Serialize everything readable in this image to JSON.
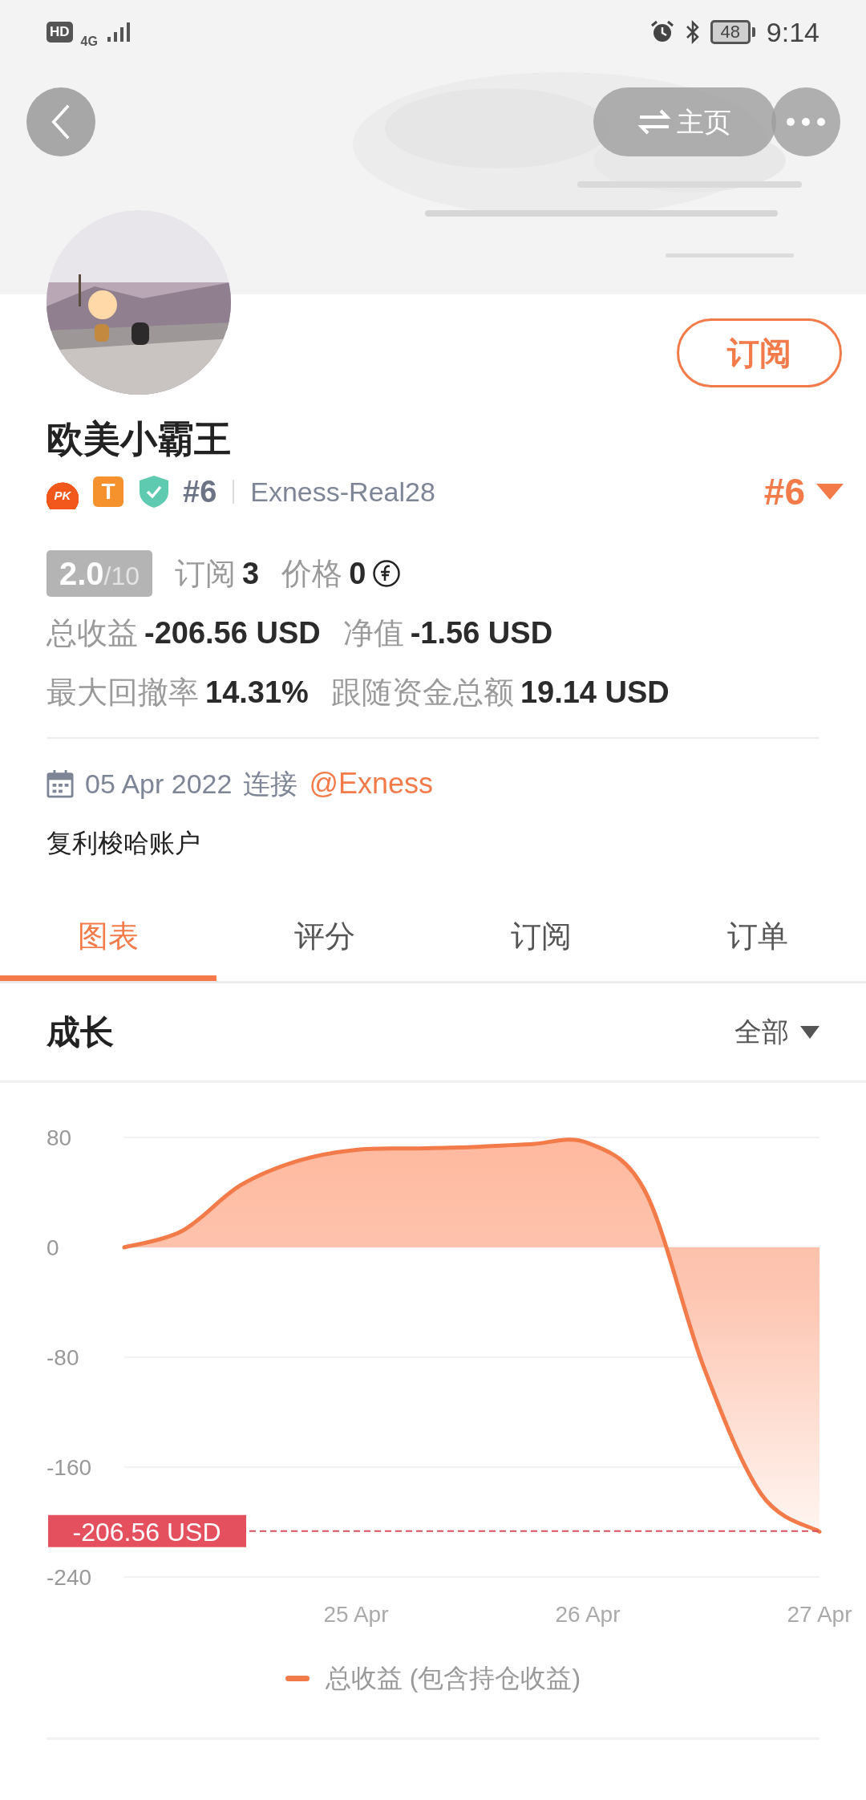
{
  "status_bar": {
    "network_badge": "HD",
    "network": "4G",
    "battery": "48",
    "time": "9:14"
  },
  "header": {
    "home_button": "主页"
  },
  "profile": {
    "name": "欧美小霸王",
    "subscribe_button": "订阅",
    "badges": [
      {
        "kind": "pk",
        "label": "PK"
      },
      {
        "kind": "letter",
        "label": "T"
      },
      {
        "kind": "verified"
      }
    ],
    "rank": "#6",
    "account": "Exness-Real28",
    "rank_selector": "#6"
  },
  "rating": {
    "score": "2.0",
    "max": "/10"
  },
  "stat_rows": [
    {
      "items": [
        {
          "label": "订阅",
          "value": "3",
          "kind": "plain"
        },
        {
          "label": "价格",
          "value": "0",
          "kind": "coin"
        }
      ]
    },
    {
      "items": [
        {
          "label": "总收益",
          "value": "-206.56 USD",
          "kind": "plain"
        },
        {
          "label": "净值",
          "value": "-1.56 USD",
          "kind": "plain"
        }
      ]
    },
    {
      "items": [
        {
          "label": "最大回撤率",
          "value": "14.31%",
          "kind": "plain"
        },
        {
          "label": "跟随资金总额",
          "value": "19.14 USD",
          "kind": "plain"
        }
      ]
    }
  ],
  "connection": {
    "date": "05 Apr 2022",
    "text": "连接",
    "broker": "@Exness"
  },
  "description": "复利梭哈账户",
  "tabs": [
    {
      "label": "图表",
      "selected": true
    },
    {
      "label": "评分",
      "selected": false
    },
    {
      "label": "订阅",
      "selected": false
    },
    {
      "label": "订单",
      "selected": false
    }
  ],
  "growth": {
    "title": "成长",
    "filter": "全部",
    "chart_data": {
      "type": "area",
      "categories": [
        null,
        null,
        null,
        null,
        "25 Apr",
        null,
        null,
        null,
        "26 Apr",
        null,
        null,
        null,
        "27 Apr"
      ],
      "series": [
        {
          "name": "总收益 (包含持仓收益)",
          "color": "#f37b4a",
          "values": [
            0,
            12,
            45,
            63,
            71,
            72,
            73,
            75,
            76,
            40,
            -87,
            -180,
            -207
          ]
        }
      ],
      "ylim": [
        -240,
        80
      ],
      "yticks": [
        80,
        0,
        -80,
        -160,
        -240
      ],
      "grid": true,
      "ref_lines": [
        {
          "axis": "y",
          "value": -206.56,
          "label": "-206.56 USD"
        }
      ]
    }
  }
}
